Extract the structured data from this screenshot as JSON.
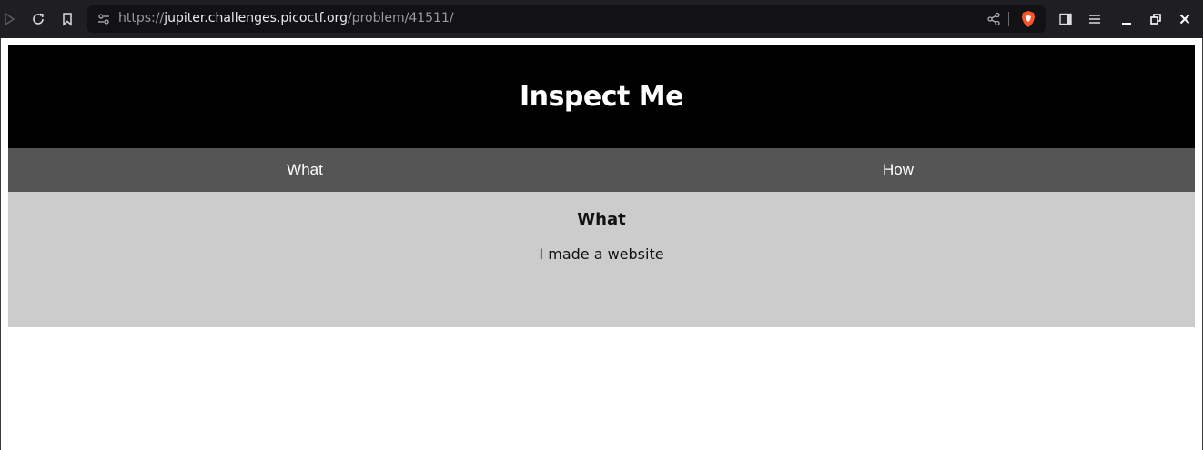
{
  "browser": {
    "url_scheme": "https://",
    "url_host": "jupiter.challenges.picoctf.org",
    "url_path": "/problem/41511/",
    "icons": [
      "play-icon",
      "reload-icon",
      "bookmark-icon",
      "site-settings-icon",
      "share-icon",
      "brave-shield-icon",
      "sidebar-icon",
      "menu-icon",
      "minimize-icon",
      "restore-icon",
      "close-icon"
    ]
  },
  "page": {
    "title": "Inspect Me",
    "tabs": [
      {
        "label": "What"
      },
      {
        "label": "How"
      }
    ],
    "content": {
      "heading": "What",
      "text": "I made a website"
    }
  }
}
